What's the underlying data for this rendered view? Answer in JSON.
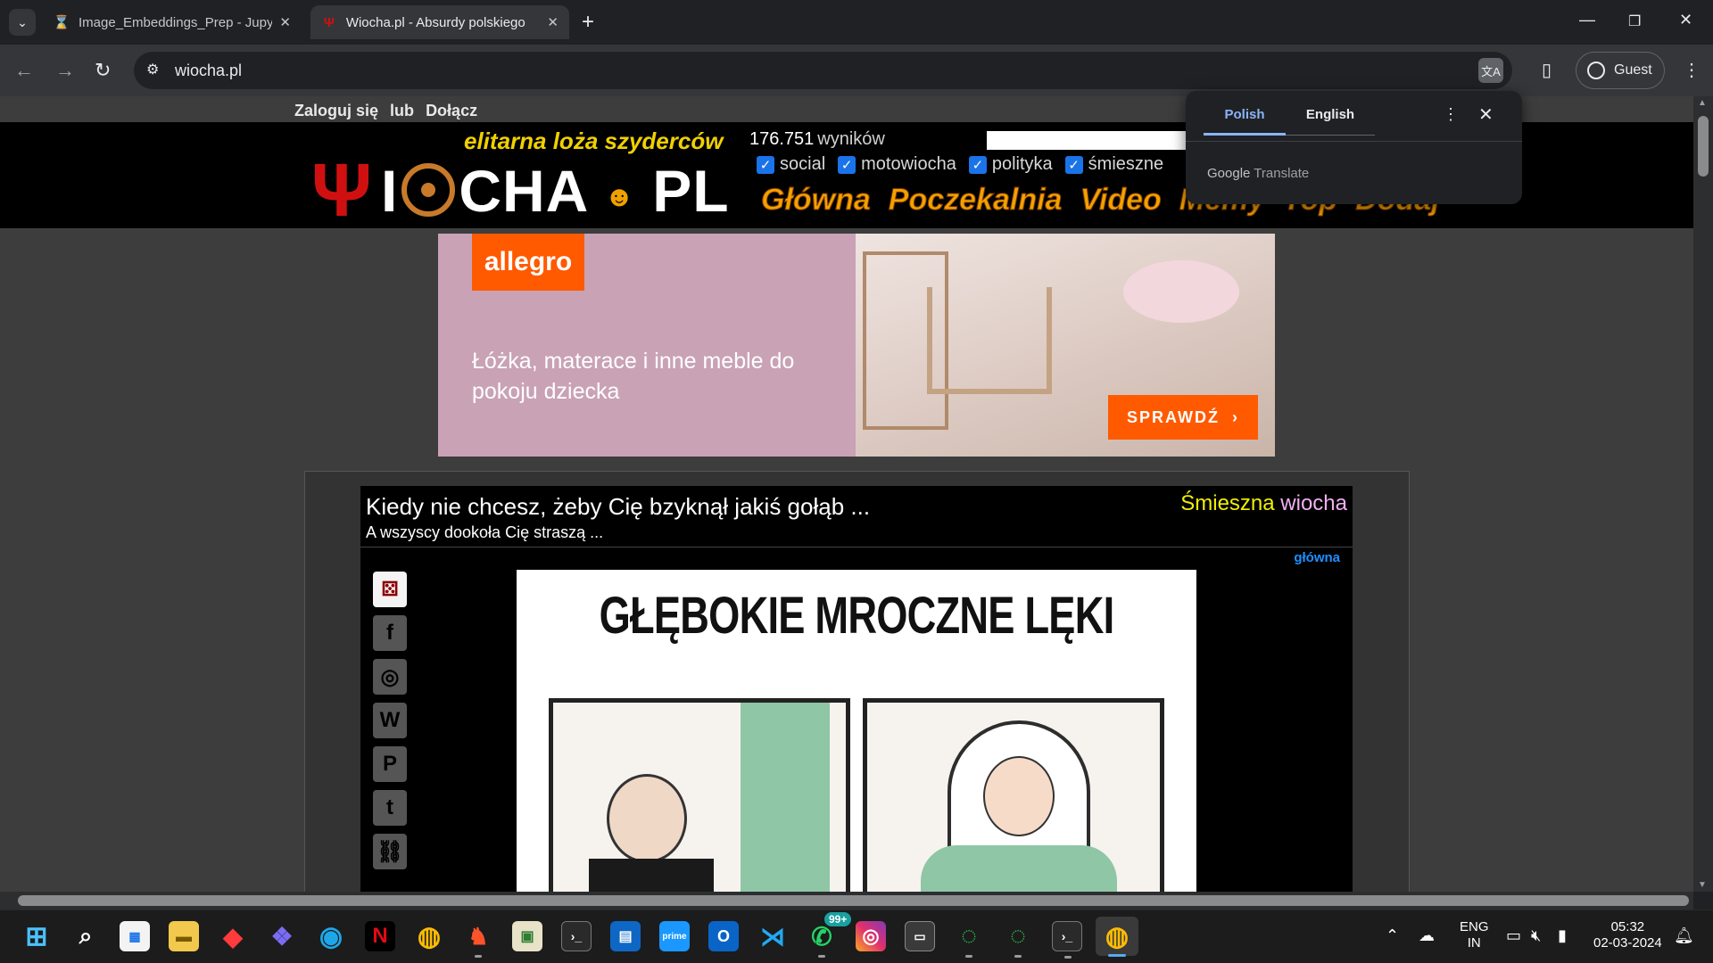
{
  "browser": {
    "tabs": [
      {
        "title": "Image_Embeddings_Prep - Jupy",
        "icon": "hourglass-icon",
        "icon_color": "#f37626",
        "active": false
      },
      {
        "title": "Wiocha.pl - Absurdy polskiego",
        "icon": "trident-icon",
        "icon_color": "#d01010",
        "active": true
      }
    ],
    "url": "wiocha.pl",
    "profile_label": "Guest"
  },
  "translate_popup": {
    "lang_source": "Polish",
    "lang_target": "English",
    "powered_by_google": "Google",
    "powered_by_product": "Translate"
  },
  "site": {
    "login": {
      "login_label": "Zaloguj się",
      "or_label": "lub",
      "join_label": "Dołącz"
    },
    "tagline": "elitarna loża szyderców",
    "logo_word_left": "I",
    "logo_word_mid": "CHA",
    "logo_word_right": "PL",
    "results_count": "176.751",
    "results_label": "wyników",
    "filters": [
      "social",
      "motowiocha",
      "polityka",
      "śmieszne"
    ],
    "nav": [
      "Główna",
      "Poczekalnia",
      "Video",
      "Memy",
      "Top",
      "Dodaj"
    ]
  },
  "ad": {
    "brand": "allegro",
    "text": "Łóżka, materace i inne meble do pokoju dziecka",
    "cta": "SPRAWDŹ",
    "brand_color": "#ff5a00"
  },
  "post": {
    "title": "Kiedy nie chcesz, żeby Cię bzyknął jakiś gołąb ...",
    "subtitle": "A wszyscy dookoła Cię straszą ...",
    "category_word1": "Śmieszna",
    "category_word2": "wiocha",
    "link_label": "główna",
    "image_heading": "GŁĘBOKIE MROCZNE LĘKI",
    "share_icons": [
      "dice-icon",
      "facebook-icon",
      "instagram-icon",
      "wykop-icon",
      "pinterest-icon",
      "twitter-icon",
      "link-icon"
    ]
  },
  "taskbar": {
    "whatsapp_badge": "99+",
    "lang_line1": "ENG",
    "lang_line2": "IN",
    "time": "05:32",
    "date": "02-03-2024"
  }
}
